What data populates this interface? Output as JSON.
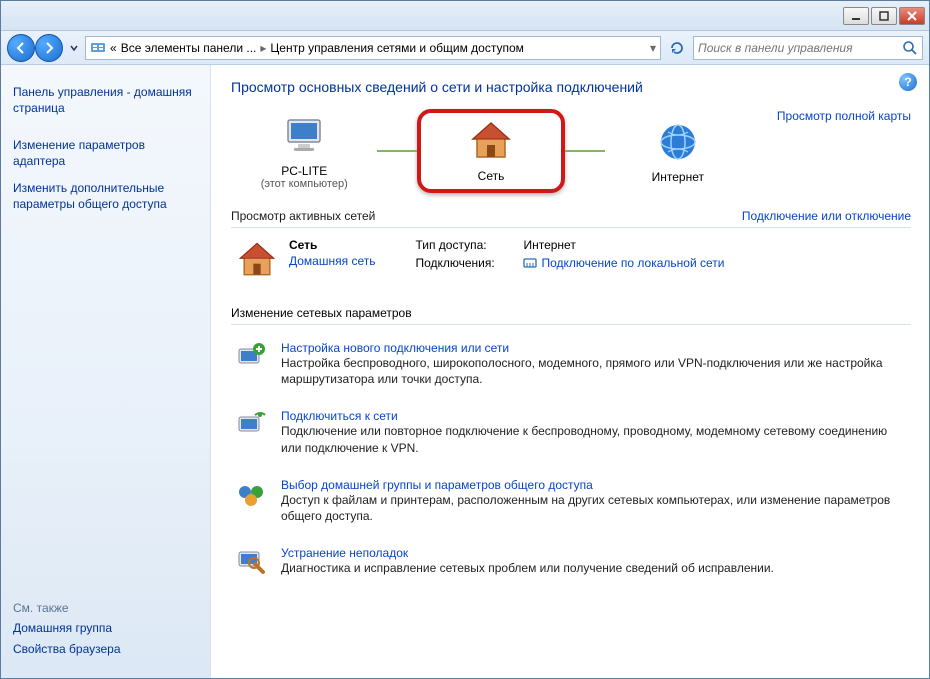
{
  "titlebar": {},
  "nav": {
    "breadcrumb_prefix": "«",
    "breadcrumb_part1": "Все элементы панели ...",
    "breadcrumb_part2": "Центр управления сетями и общим доступом",
    "search_placeholder": "Поиск в панели управления"
  },
  "sidebar": {
    "home": "Панель управления - домашняя страница",
    "adapter": "Изменение параметров адаптера",
    "sharing": "Изменить дополнительные параметры общего доступа",
    "see_also": "См. также",
    "homegroup": "Домашняя группа",
    "browser": "Свойства браузера"
  },
  "main": {
    "heading": "Просмотр основных сведений о сети и настройка подключений",
    "full_map": "Просмотр полной карты",
    "node_pc": "PC-LITE",
    "node_pc_sub": "(этот компьютер)",
    "node_net": "Сеть",
    "node_internet": "Интернет",
    "active_title": "Просмотр активных сетей",
    "connect_toggle": "Подключение или отключение",
    "net_name": "Сеть",
    "net_type": "Домашняя сеть",
    "access_label": "Тип доступа:",
    "access_value": "Интернет",
    "conn_label": "Подключения:",
    "conn_value": "Подключение по локальной сети",
    "change_title": "Изменение сетевых параметров",
    "task1_title": "Настройка нового подключения или сети",
    "task1_desc": "Настройка беспроводного, широкополосного, модемного, прямого или VPN-подключения или же настройка маршрутизатора или точки доступа.",
    "task2_title": "Подключиться к сети",
    "task2_desc": "Подключение или повторное подключение к беспроводному, проводному, модемному сетевому соединению или подключение к VPN.",
    "task3_title": "Выбор домашней группы и параметров общего доступа",
    "task3_desc": "Доступ к файлам и принтерам, расположенным на других сетевых компьютерах, или изменение параметров общего доступа.",
    "task4_title": "Устранение неполадок",
    "task4_desc": "Диагностика и исправление сетевых проблем или получение сведений об исправлении."
  }
}
